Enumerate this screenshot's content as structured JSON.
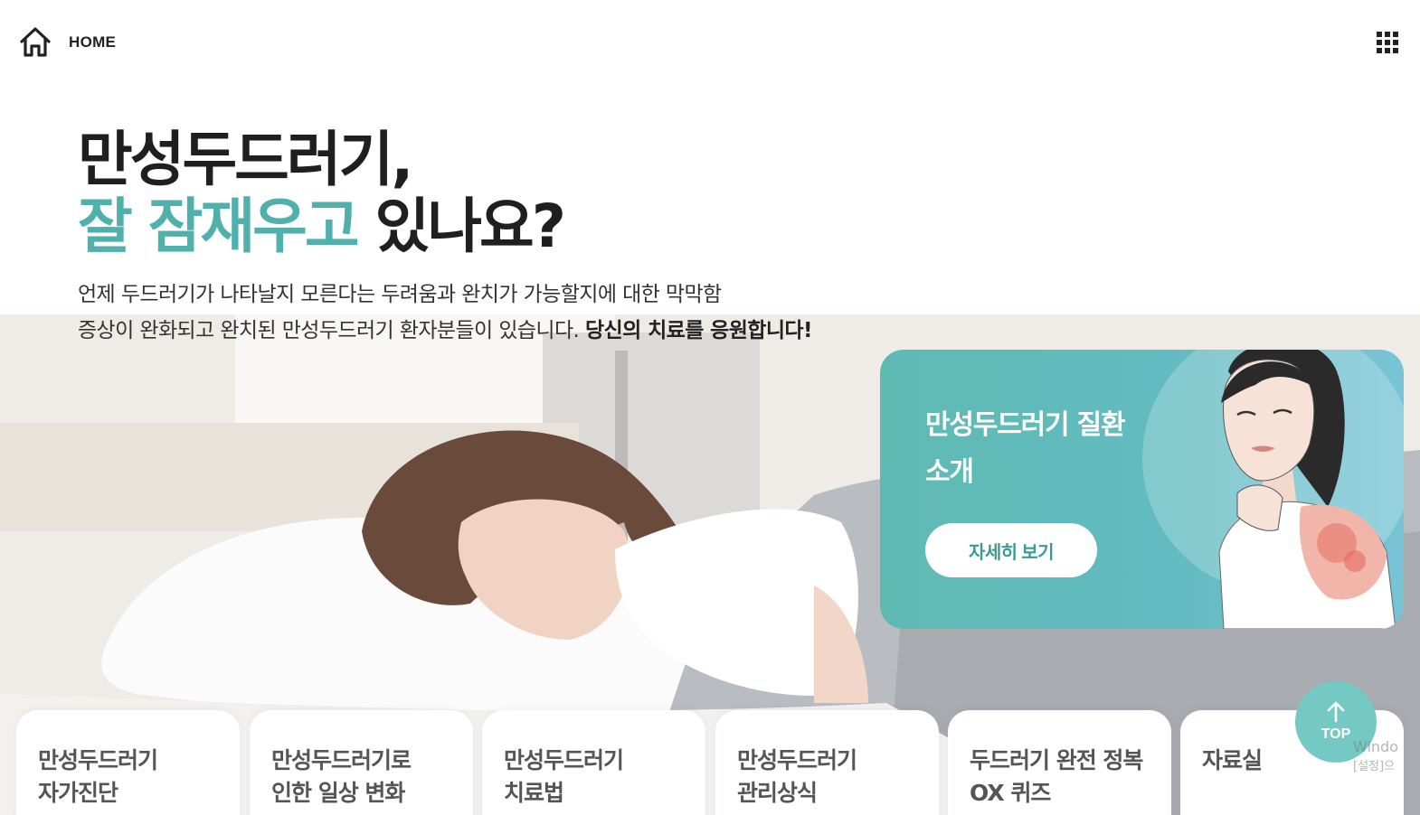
{
  "header": {
    "home_label": "HOME",
    "home_icon": "home-icon",
    "menu_icon": "grid-menu-icon"
  },
  "hero": {
    "headline_line1": "만성두드러기,",
    "headline_accent": "잘 잠재우고",
    "headline_rest": " 있나요?",
    "subtext_line1": "언제 두드러기가 나타날지 모른다는 두려움과 완치가 가능할지에 대한 막막함",
    "subtext_line2": "증상이 완화되고 완치된 만성두드러기 환자분들이 있습니다. ",
    "subtext_bold": "당신의 치료를 응원합니다!",
    "accent_color": "#4fb0ac"
  },
  "intro_card": {
    "title": "만성두드러기 질환 소개",
    "button_label": "자세히 보기",
    "card_color": "#5fb9b3"
  },
  "nav_cards": [
    {
      "label": "만성두드러기\n자가진단"
    },
    {
      "label": "만성두드러기로\n인한 일상 변화"
    },
    {
      "label": "만성두드러기\n치료법"
    },
    {
      "label": "만성두드러기\n관리상식"
    },
    {
      "label": "두드러기 완전 정복\nOX 퀴즈"
    },
    {
      "label": "자료실"
    }
  ],
  "top_button": {
    "label": "TOP",
    "icon": "arrow-up-icon",
    "color": "#74c9c4"
  },
  "watermark": {
    "line1": "Windo",
    "line2": "[설정]으"
  }
}
